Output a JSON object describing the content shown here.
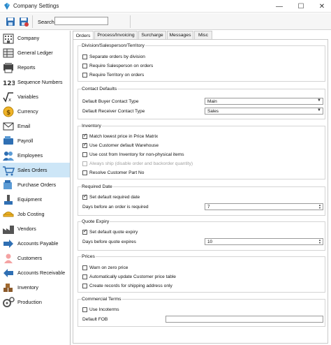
{
  "window": {
    "title": "Company Settings"
  },
  "toolbar": {
    "search_label": "Search",
    "search_value": ""
  },
  "sidebar": {
    "items": [
      {
        "label": "Company",
        "icon": "building-icon"
      },
      {
        "label": "General Ledger",
        "icon": "ledger-icon"
      },
      {
        "label": "Reports",
        "icon": "reports-icon"
      },
      {
        "label": "Sequence Numbers",
        "icon": "sequence-icon"
      },
      {
        "label": "Variables",
        "icon": "variables-icon"
      },
      {
        "label": "Currency",
        "icon": "currency-icon"
      },
      {
        "label": "Email",
        "icon": "email-icon"
      },
      {
        "label": "Payroll",
        "icon": "payroll-icon"
      },
      {
        "label": "Employees",
        "icon": "employees-icon"
      },
      {
        "label": "Sales Orders",
        "icon": "sales-orders-icon"
      },
      {
        "label": "Purchase Orders",
        "icon": "purchase-orders-icon"
      },
      {
        "label": "Equipment",
        "icon": "equipment-icon"
      },
      {
        "label": "Job Costing",
        "icon": "job-costing-icon"
      },
      {
        "label": "Vendors",
        "icon": "vendors-icon"
      },
      {
        "label": "Accounts Payable",
        "icon": "accounts-payable-icon"
      },
      {
        "label": "Customers",
        "icon": "customers-icon"
      },
      {
        "label": "Accounts Receivable",
        "icon": "accounts-receivable-icon"
      },
      {
        "label": "Inventory",
        "icon": "inventory-icon"
      },
      {
        "label": "Production",
        "icon": "production-icon"
      }
    ],
    "active": "Sales Orders"
  },
  "tabs": [
    {
      "label": "Orders",
      "active": true
    },
    {
      "label": "Process/Invoicing",
      "active": false
    },
    {
      "label": "Surcharge",
      "active": false
    },
    {
      "label": "Messages",
      "active": false
    },
    {
      "label": "Misc",
      "active": false
    }
  ],
  "groups": {
    "division": {
      "title": "Division/Salesperson/Territory",
      "items": [
        {
          "label": "Separate orders by division",
          "checked": false
        },
        {
          "label": "Require Salesperson on orders",
          "checked": false
        },
        {
          "label": "Require Territory on orders",
          "checked": false
        }
      ]
    },
    "contact": {
      "title": "Contact Defaults",
      "buyer_label": "Default Buyer Contact Type",
      "buyer_value": "Main",
      "receiver_label": "Default Receiver Contact Type",
      "receiver_value": "Sales"
    },
    "inventory": {
      "title": "Inventory",
      "items": [
        {
          "label": "Match lowest price in Price Matrix",
          "checked": true,
          "disabled": false
        },
        {
          "label": "Use Customer default Warehouse",
          "checked": true,
          "disabled": false
        },
        {
          "label": "Use cost from Inventory for non-physical items",
          "checked": false,
          "disabled": false
        },
        {
          "label": "Always ship (disable order and backorder quantity)",
          "checked": false,
          "disabled": true
        },
        {
          "label": "Resolve Customer Part No",
          "checked": false,
          "disabled": false
        }
      ]
    },
    "required_date": {
      "title": "Required Date",
      "set_label": "Set default required date",
      "set_checked": true,
      "days_label": "Days before an order is required",
      "days_value": "7"
    },
    "quote_expiry": {
      "title": "Quote Expiry",
      "set_label": "Set default quote expiry",
      "set_checked": true,
      "days_label": "Days before quote expires",
      "days_value": "10"
    },
    "prices": {
      "title": "Prices",
      "items": [
        {
          "label": "Warn on zero price",
          "checked": false
        },
        {
          "label": "Automatically update Customer price table",
          "checked": false
        },
        {
          "label": "Create records for shipping address only",
          "checked": false
        }
      ]
    },
    "commercial": {
      "title": "Commercial Terms",
      "incoterms_label": "Use Incoterms",
      "incoterms_checked": false,
      "fob_label": "Default FOB",
      "fob_value": ""
    }
  }
}
